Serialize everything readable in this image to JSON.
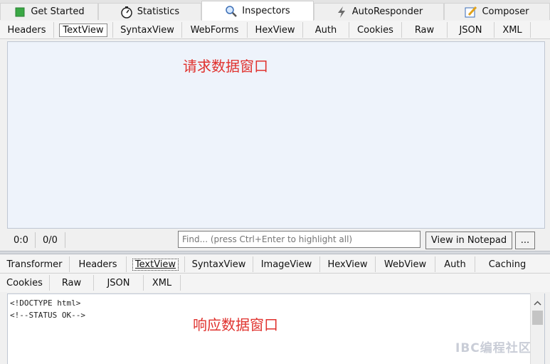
{
  "main_tabs": [
    {
      "label": "Get Started",
      "icon": "green-square-icon"
    },
    {
      "label": "Statistics",
      "icon": "stopwatch-icon"
    },
    {
      "label": "Inspectors",
      "icon": "magnifier-icon"
    },
    {
      "label": "AutoResponder",
      "icon": "lightning-icon"
    },
    {
      "label": "Composer",
      "icon": "pencil-note-icon"
    }
  ],
  "request_tabs": [
    "Headers",
    "TextView",
    "SyntaxView",
    "WebForms",
    "HexView",
    "Auth",
    "Cookies",
    "Raw",
    "JSON",
    "XML"
  ],
  "request_active": "TextView",
  "request_overlay": "请求数据窗口",
  "status": {
    "position": "0:0",
    "count": "0/0",
    "find_placeholder": "Find... (press Ctrl+Enter to highlight all)",
    "notepad_button": "View in Notepad",
    "more_button": "..."
  },
  "response_tabs_row1": [
    "Transformer",
    "Headers",
    "TextView",
    "SyntaxView",
    "ImageView",
    "HexView",
    "WebView",
    "Auth",
    "Caching"
  ],
  "response_tabs_row2": [
    "Cookies",
    "Raw",
    "JSON",
    "XML"
  ],
  "response_active": "TextView",
  "response_body": [
    "<!DOCTYPE html>",
    "<!--STATUS OK-->"
  ],
  "response_overlay": "响应数据窗口",
  "watermark": "IBC编程社区",
  "colors": {
    "overlay": "#e0322e",
    "request_bg": "#eef3fb"
  }
}
